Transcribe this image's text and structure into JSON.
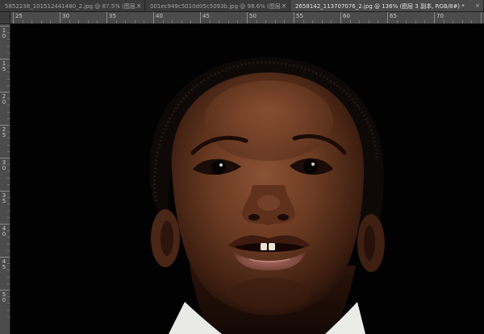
{
  "tabs": [
    {
      "label": "5852238_101512441480_2.jpg @ 87.5% (图层...",
      "close": "×",
      "active": false
    },
    {
      "label": "001ec949c5010d05c5093b.jpg @ 98.6% (图层...",
      "close": "×",
      "active": false
    },
    {
      "label": "2658142_113707076_2.jpg @ 136% (图层 3 副本, RGB/8#) *",
      "close": "×",
      "active": true
    }
  ],
  "ruler_h": [
    "25",
    "30",
    "35",
    "40",
    "45",
    "50",
    "55",
    "60",
    "65",
    "70",
    "75"
  ],
  "ruler_v": [
    "10",
    "15",
    "20",
    "25",
    "30",
    "35",
    "40",
    "45",
    "50"
  ],
  "colors": {
    "ui_dark": "#282828",
    "ruler": "#4b4b4b",
    "tab_active": "#4a4a4a",
    "canvas_bg": "#020202",
    "skin": "#6a3a22"
  }
}
